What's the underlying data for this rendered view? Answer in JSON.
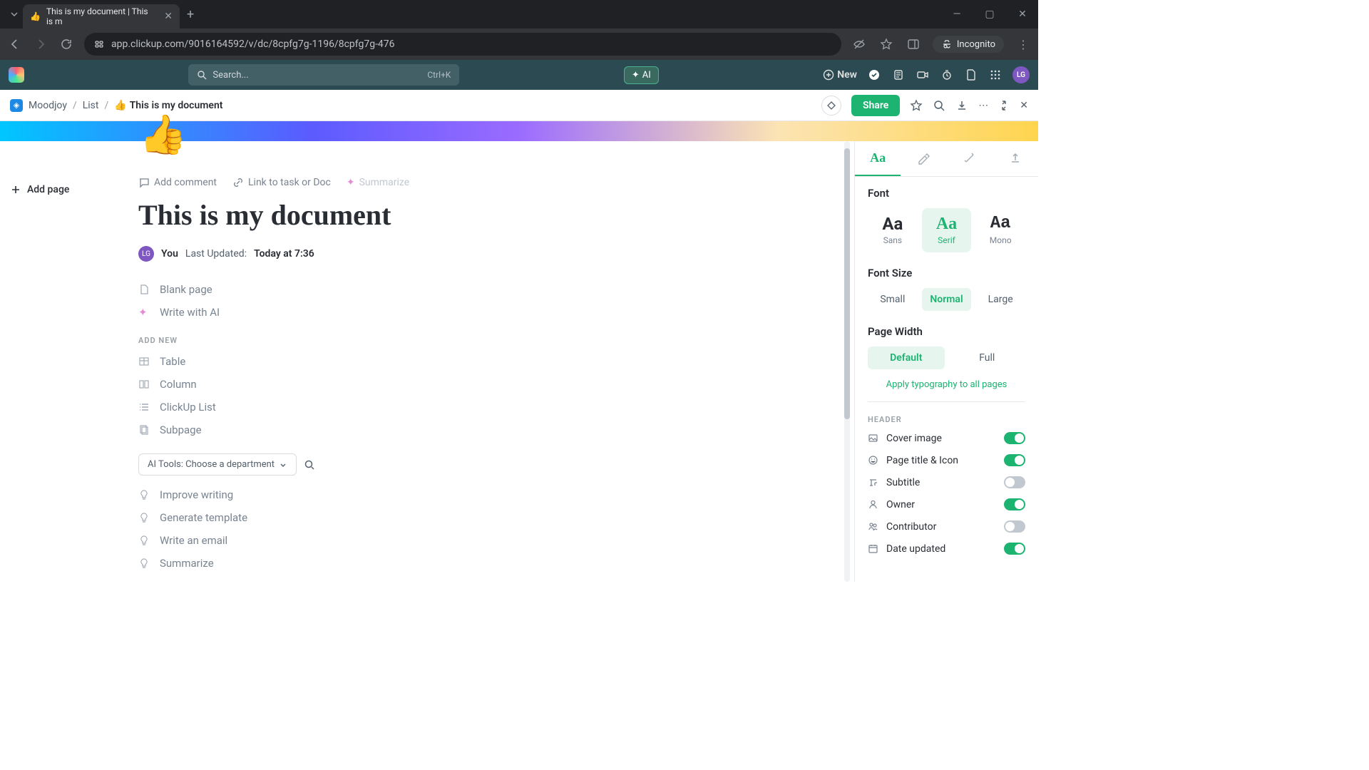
{
  "browser": {
    "tab_title": "This is my document | This is m",
    "tab_emoji": "👍",
    "url": "app.clickup.com/9016164592/v/dc/8cpfg7g-1196/8cpfg7g-476",
    "incognito": "Incognito"
  },
  "app_header": {
    "search_placeholder": "Search...",
    "search_shortcut": "Ctrl+K",
    "ai_label": "AI",
    "new_label": "New",
    "avatar_initials": "LG"
  },
  "breadcrumb": {
    "workspace": "Moodjoy",
    "list": "List",
    "doc_emoji": "👍",
    "doc_name": "This is my document",
    "share_label": "Share"
  },
  "cover": {
    "emoji": "👍"
  },
  "sidebar": {
    "add_page": "Add page"
  },
  "document": {
    "actions": {
      "add_comment": "Add comment",
      "link_task": "Link to task or Doc",
      "summarize": "Summarize"
    },
    "title": "This is my document",
    "meta": {
      "author_initials": "LG",
      "author_label": "You",
      "updated_prefix": "Last Updated:",
      "updated_value": "Today at 7:36"
    },
    "quick_blocks": {
      "blank": "Blank page",
      "write_ai": "Write with AI"
    },
    "add_new_label": "ADD NEW",
    "add_new_items": {
      "table": "Table",
      "column": "Column",
      "list": "ClickUp List",
      "subpage": "Subpage"
    },
    "ai_tools_label": "AI Tools: Choose a department",
    "ai_items": {
      "improve": "Improve writing",
      "template": "Generate template",
      "email": "Write an email",
      "summarize": "Summarize"
    }
  },
  "settings": {
    "font_heading": "Font",
    "font_options": {
      "sans": "Sans",
      "serif": "Serif",
      "mono": "Mono"
    },
    "font_sample": "Aa",
    "fontsize_heading": "Font Size",
    "fontsize_options": {
      "small": "Small",
      "normal": "Normal",
      "large": "Large"
    },
    "pagewidth_heading": "Page Width",
    "pagewidth_options": {
      "default": "Default",
      "full": "Full"
    },
    "apply_all": "Apply typography to all pages",
    "header_label": "HEADER",
    "toggles": {
      "cover": "Cover image",
      "title_icon": "Page title & Icon",
      "subtitle": "Subtitle",
      "owner": "Owner",
      "contributor": "Contributor",
      "date_updated": "Date updated"
    }
  }
}
